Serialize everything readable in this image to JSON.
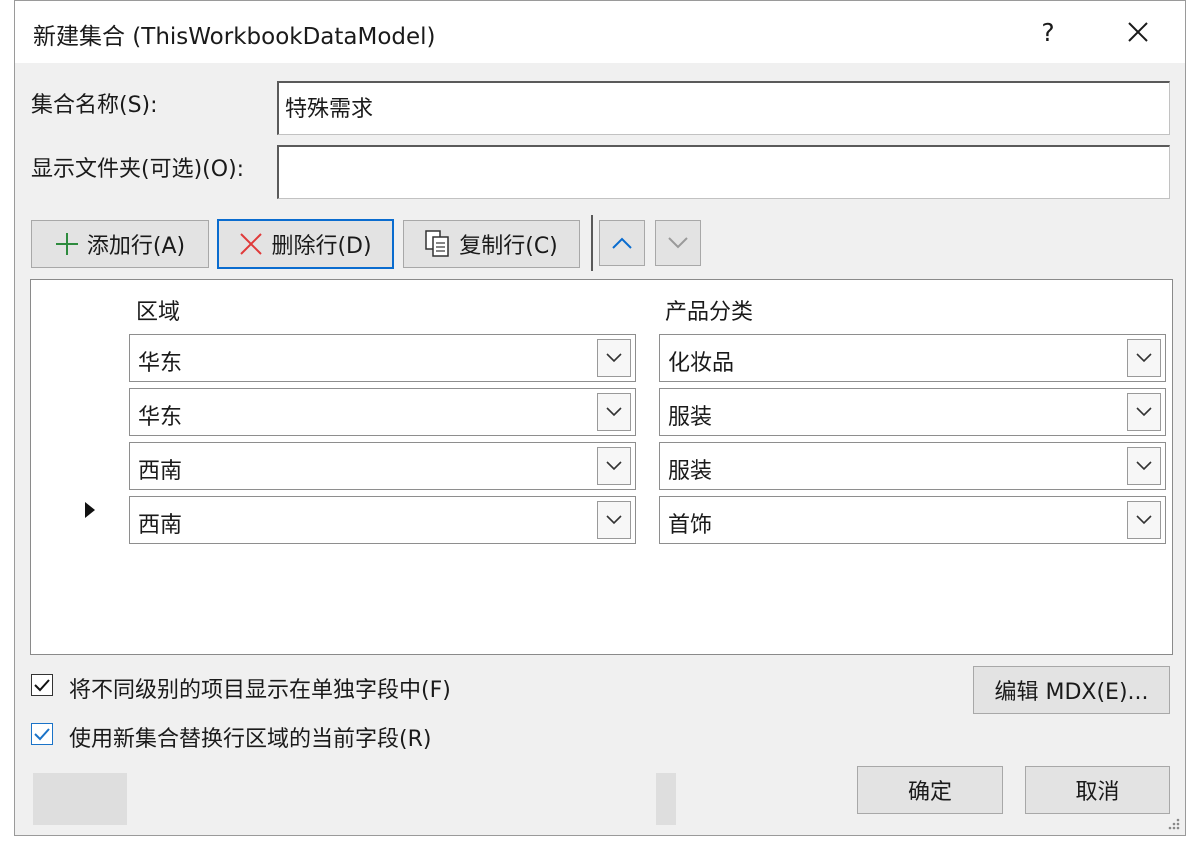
{
  "title": "新建集合 (ThisWorkbookDataModel)",
  "window_controls": {
    "help": "?"
  },
  "set_name": {
    "label": "集合名称(S):",
    "value": "特殊需求"
  },
  "display_folder": {
    "label": "显示文件夹(可选)(O):",
    "value": ""
  },
  "toolbar": {
    "add_row": "添加行(A)",
    "delete_row": "删除行(D)",
    "copy_row": "复制行(C)"
  },
  "grid": {
    "columns": [
      "区域",
      "产品分类"
    ],
    "rows": [
      [
        "华东",
        "化妆品"
      ],
      [
        "华东",
        "服装"
      ],
      [
        "西南",
        "服装"
      ],
      [
        "西南",
        "首饰"
      ]
    ],
    "current_row_index": 3
  },
  "options": {
    "separate_fields": {
      "label": "将不同级别的项目显示在单独字段中(F)",
      "checked": true
    },
    "replace_fields": {
      "label": "使用新集合替换行区域的当前字段(R)",
      "checked": true
    }
  },
  "buttons": {
    "edit_mdx": "编辑 MDX(E)...",
    "ok": "确定",
    "cancel": "取消"
  },
  "colors": {
    "accent": "#0a6ccf",
    "delete_icon": "#e03a3a",
    "add_icon": "#2e8b3e"
  }
}
